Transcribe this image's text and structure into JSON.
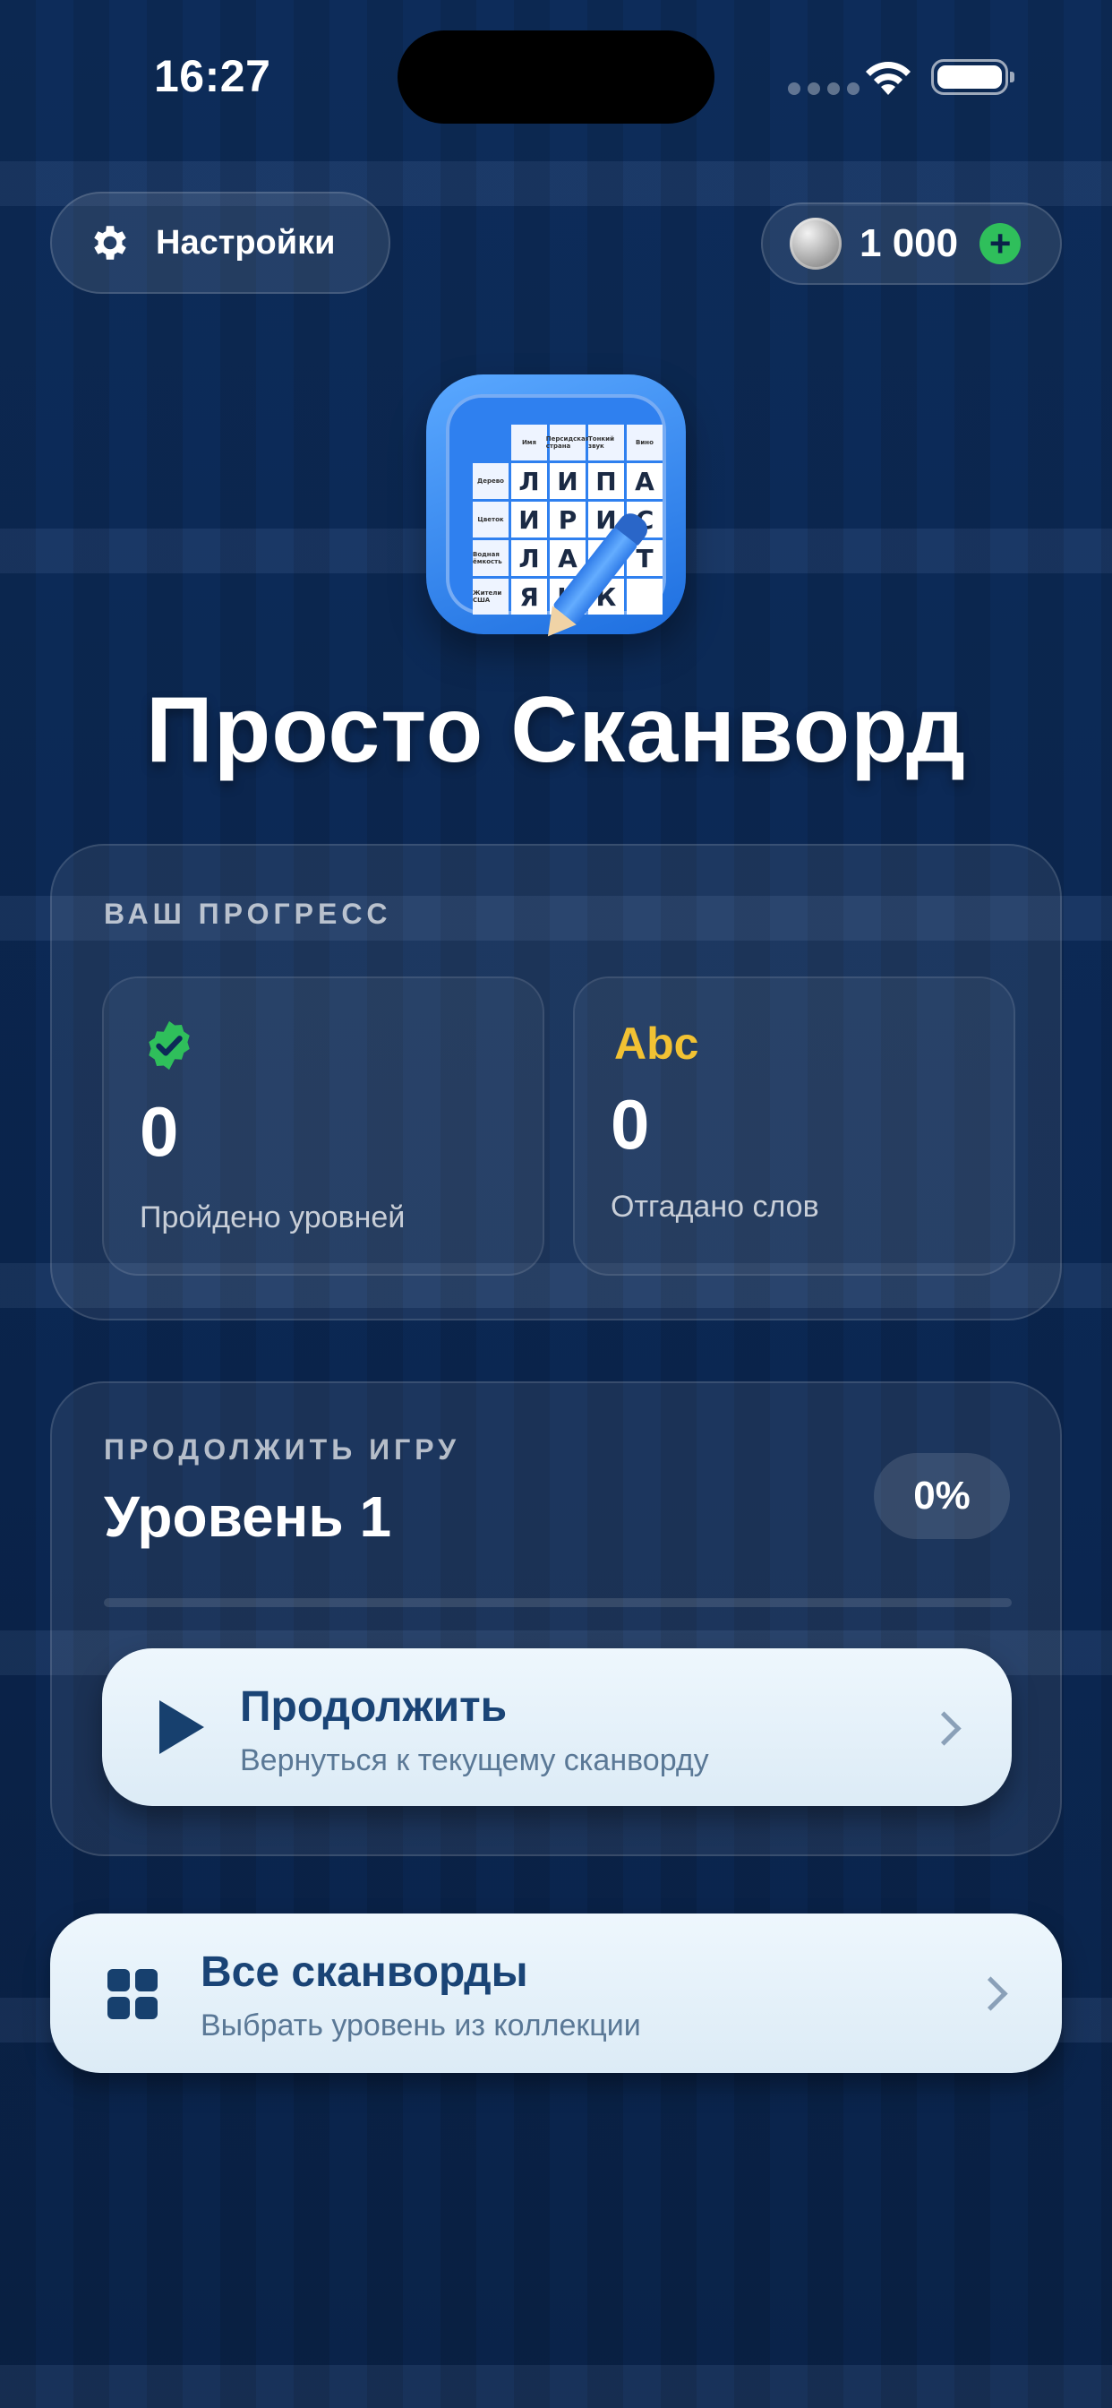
{
  "status_bar": {
    "time": "16:27"
  },
  "header": {
    "settings_label": "Настройки",
    "coins": "1 000",
    "add_coins_symbol": "+"
  },
  "app": {
    "title": "Просто Сканворд",
    "icon_grid": {
      "clues_top": [
        "Имя",
        "Персидская страна",
        "Тонкий звук",
        "Вино"
      ],
      "rows": [
        {
          "clue": "Дерево",
          "letters": [
            "Л",
            "И",
            "П",
            "А"
          ]
        },
        {
          "clue": "Цветок",
          "letters": [
            "И",
            "Р",
            "И",
            "С"
          ]
        },
        {
          "clue": "Водная ёмкость",
          "letters": [
            "Л",
            "А",
            "С",
            "Т"
          ]
        },
        {
          "clue": "Жители США",
          "letters": [
            "Я",
            "Н",
            "К",
            ""
          ]
        }
      ]
    }
  },
  "progress": {
    "section_label": "ВАШ ПРОГРЕСС",
    "levels_completed": {
      "value": "0",
      "label": "Пройдено уровней"
    },
    "words_guessed": {
      "icon_text": "Abc",
      "value": "0",
      "label": "Отгадано слов"
    }
  },
  "continue_game": {
    "section_label": "ПРОДОЛЖИТЬ ИГРУ",
    "level_title": "Уровень 1",
    "percent": "0%",
    "progress_fraction": 0,
    "button": {
      "title": "Продолжить",
      "subtitle": "Вернуться к текущему сканворду"
    }
  },
  "all_scanwords": {
    "title": "Все сканворды",
    "subtitle": "Выбрать уровень из коллекции"
  },
  "colors": {
    "background": "#0c2a57",
    "accent_green": "#2fbf5b",
    "abc_yellow": "#f2c233",
    "button_text": "#17406e"
  },
  "icons": [
    "gear-icon",
    "coin-icon",
    "plus-icon",
    "verified-badge-icon",
    "abc-icon",
    "play-icon",
    "chevron-right-icon",
    "grid-icon"
  ]
}
